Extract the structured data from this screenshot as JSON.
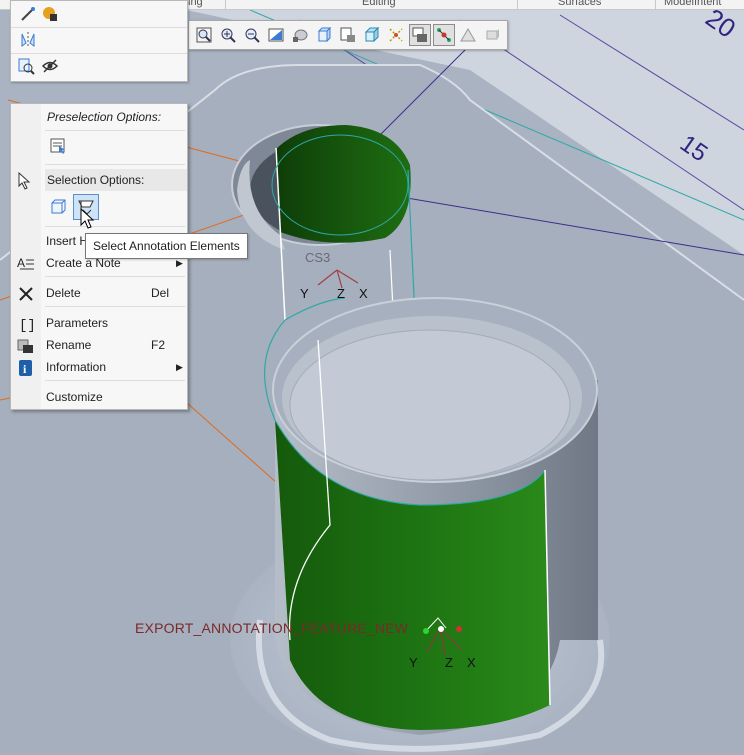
{
  "ribbon": {
    "groups": [
      "ing",
      "Editing",
      "Surfaces",
      "ModelIntent"
    ]
  },
  "toolbar": {
    "buttons": [
      {
        "name": "refit-icon",
        "active": false
      },
      {
        "name": "zoom-in-icon",
        "active": false
      },
      {
        "name": "zoom-out-icon",
        "active": false
      },
      {
        "name": "repaint-icon",
        "active": false
      },
      {
        "name": "display-style-icon",
        "active": false
      },
      {
        "name": "saved-orientations-icon",
        "active": false
      },
      {
        "name": "view-manager-icon",
        "active": false
      },
      {
        "name": "perspective-view-icon",
        "active": false
      },
      {
        "name": "datum-display-filters-icon",
        "active": false
      },
      {
        "name": "annotation-display-icon",
        "active": true
      },
      {
        "name": "spin-center-icon",
        "active": true
      },
      {
        "name": "glyph-display-icon",
        "active": false
      },
      {
        "name": "appearance-gallery-icon",
        "active": false
      }
    ]
  },
  "context_menu": {
    "preselection_header": "Preselection Options:",
    "selection_header": "Selection Options:",
    "items": [
      {
        "label": "Insert H",
        "shortcut": "",
        "submenu": false
      },
      {
        "label": "Create a Note",
        "shortcut": "",
        "submenu": true
      },
      {
        "label": "Delete",
        "shortcut": "Del",
        "submenu": false
      },
      {
        "label": "Parameters",
        "shortcut": "",
        "submenu": false
      },
      {
        "label": "Rename",
        "shortcut": "F2",
        "submenu": false
      },
      {
        "label": "Information",
        "shortcut": "",
        "submenu": true
      },
      {
        "label": "Customize",
        "shortcut": "",
        "submenu": false
      }
    ]
  },
  "tooltip": {
    "text": "Select Annotation Elements"
  },
  "model": {
    "dimension_top": "20",
    "dimension_side": "15",
    "csys_small": {
      "name": "CS3",
      "axes": [
        "Y",
        "Z",
        "X"
      ]
    },
    "csys_large": {
      "name": "EXPORT_ANNOTATION_FEATURE_NEW",
      "axes": [
        "Y",
        "Z",
        "X"
      ]
    }
  },
  "colors": {
    "background": "#a9b3c2",
    "plate": "#a6afbd",
    "cylinder_green": "#1e6e12",
    "datum_orange": "#e06a1e",
    "datum_purple": "#3c2d8c",
    "csys_red": "#c84040",
    "menu_bg": "#f7f7f7"
  }
}
